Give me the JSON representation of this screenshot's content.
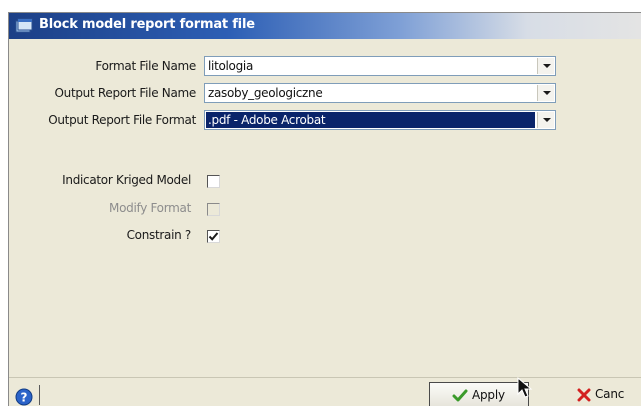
{
  "window": {
    "title": "Block model report format file"
  },
  "fields": {
    "format_file_name": {
      "label": "Format File Name",
      "value": "litologia"
    },
    "output_report_file_name": {
      "label": "Output Report File Name",
      "value": "zasoby_geologiczne"
    },
    "output_report_file_format": {
      "label": "Output Report File Format",
      "value": ".pdf - Adobe Acrobat"
    }
  },
  "checkboxes": {
    "indicator_kriged_model": {
      "label": "Indicator Kriged Model",
      "checked": false,
      "enabled": true
    },
    "modify_format": {
      "label": "Modify Format",
      "checked": false,
      "enabled": false
    },
    "constrain": {
      "label": "Constrain ?",
      "checked": true,
      "enabled": true
    }
  },
  "buttons": {
    "apply_label": "Apply",
    "cancel_label": "Canc"
  },
  "icons": {
    "title": "window-icon",
    "help": "help-icon",
    "apply": "checkmark-icon",
    "cancel": "x-icon",
    "cursor": "mouse-cursor-icon"
  },
  "colors": {
    "title_bar": "#2d5fb5",
    "selection": "#0a246a",
    "dialog_bg": "#ece9d8"
  }
}
